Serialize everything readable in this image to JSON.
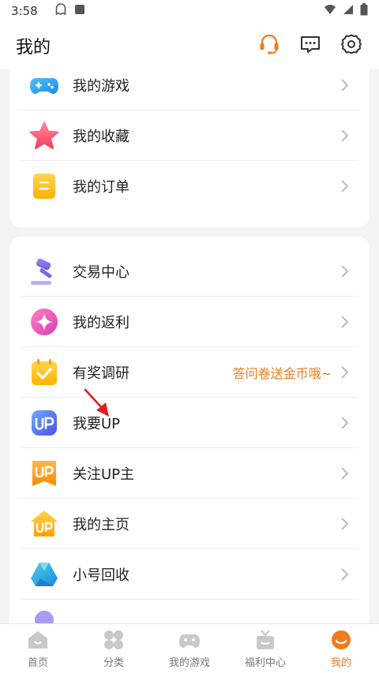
{
  "status_bar": {
    "time": "3:58"
  },
  "header": {
    "title": "我的"
  },
  "card1": {
    "items": [
      {
        "label": "我的游戏",
        "icon": "gamepad-icon"
      },
      {
        "label": "我的收藏",
        "icon": "star-icon"
      },
      {
        "label": "我的订单",
        "icon": "order-icon"
      }
    ]
  },
  "card2": {
    "items": [
      {
        "label": "交易中心",
        "icon": "gavel-icon"
      },
      {
        "label": "我的返利",
        "icon": "rebate-icon"
      },
      {
        "label": "有奖调研",
        "icon": "survey-icon",
        "note": "答问卷送金币哦~"
      },
      {
        "label": "我要UP",
        "icon": "up-icon"
      },
      {
        "label": "关注UP主",
        "icon": "follow-up-icon"
      },
      {
        "label": "我的主页",
        "icon": "home-page-icon"
      },
      {
        "label": "小号回收",
        "icon": "recycle-icon"
      }
    ]
  },
  "bottom_nav": {
    "items": [
      {
        "label": "首页",
        "icon": "home-icon"
      },
      {
        "label": "分类",
        "icon": "category-icon"
      },
      {
        "label": "我的游戏",
        "icon": "controller-icon"
      },
      {
        "label": "福利中心",
        "icon": "gift-icon"
      },
      {
        "label": "我的",
        "icon": "profile-icon",
        "active": true
      }
    ]
  },
  "colors": {
    "accent": "#f07b1c"
  }
}
